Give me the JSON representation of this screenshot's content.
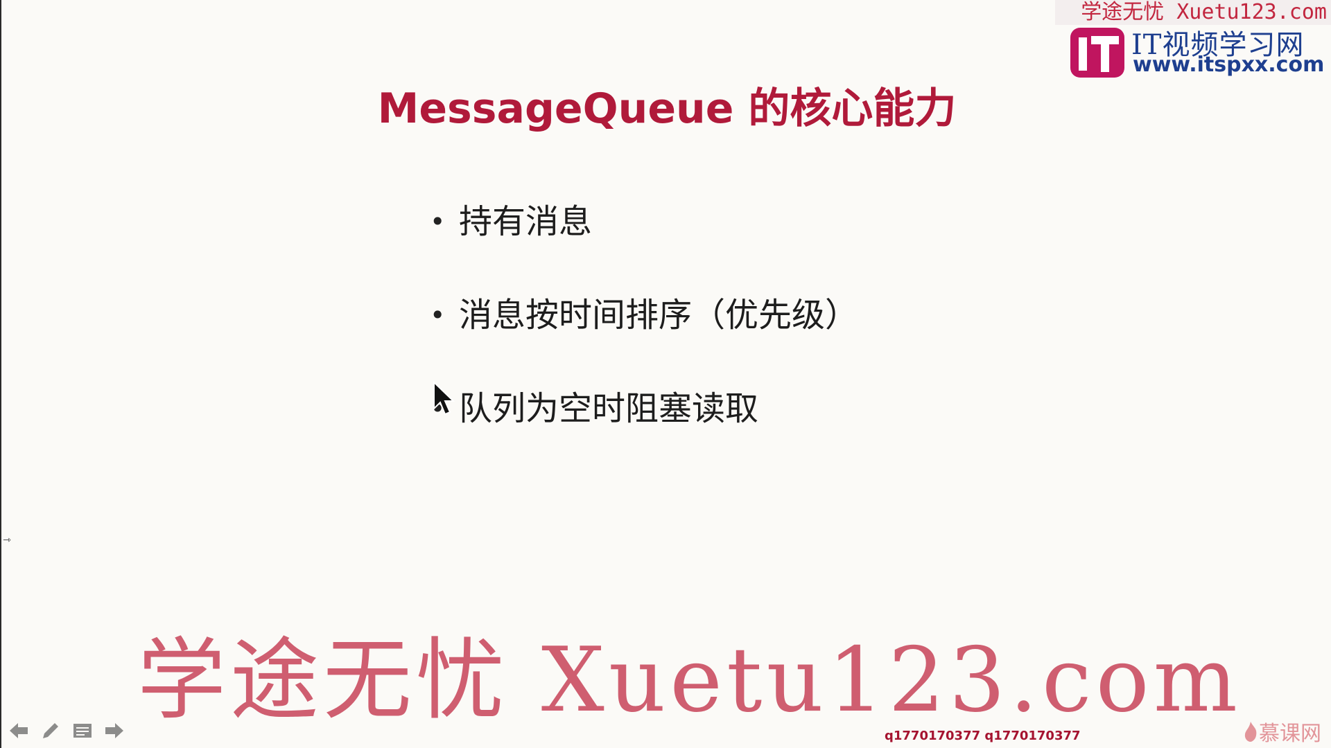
{
  "slide": {
    "title": "MessageQueue 的核心能力",
    "bullets": [
      {
        "text": "持有消息"
      },
      {
        "text": "消息按时间排序（优先级）"
      },
      {
        "text": "队列为空时阻塞读取"
      }
    ],
    "bullet_symbol": "•"
  },
  "watermarks": {
    "top_banner": "学途无忧 Xuetu123.com",
    "logo_line1": "IT视频学习网",
    "logo_line2": "www.itspxx.com",
    "logo_mark": "IT",
    "big_overlay": "学途无忧 Xuetu123.com",
    "qq_numbers": "q1770170377 q1770170377",
    "mooc_label": "慕课网"
  },
  "toolbar": {
    "items": [
      "previous-slide",
      "pen-tool",
      "slide-menu",
      "next-slide"
    ]
  },
  "colors": {
    "title": "#b01a3a",
    "watermark": "#c2263f",
    "logo_blue": "#1e3f8f",
    "logo_magenta": "#c0155f"
  }
}
